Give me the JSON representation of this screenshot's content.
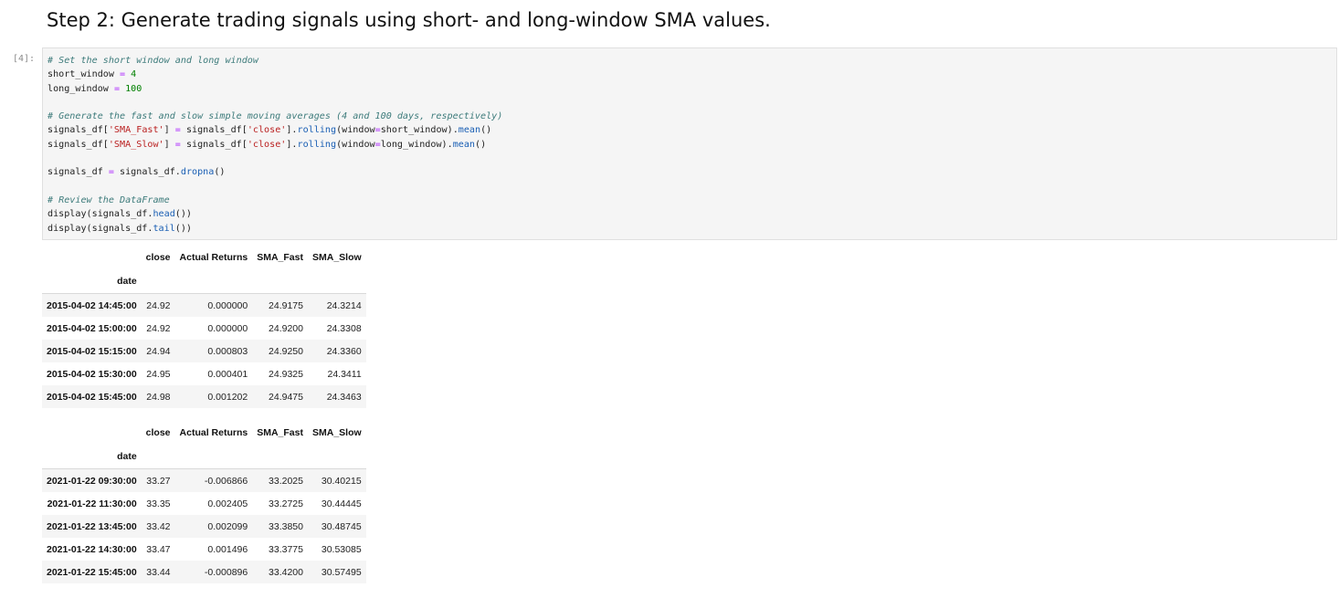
{
  "heading": "Step 2: Generate trading signals using short- and long-window SMA values.",
  "cell": {
    "prompt": "[4]:",
    "lines": [
      [
        [
          "comment",
          "# Set the short window and long window"
        ]
      ],
      [
        [
          "plain",
          "short_window "
        ],
        [
          "op",
          "="
        ],
        [
          "plain",
          " "
        ],
        [
          "number",
          "4"
        ]
      ],
      [
        [
          "plain",
          "long_window "
        ],
        [
          "op",
          "="
        ],
        [
          "plain",
          " "
        ],
        [
          "number",
          "100"
        ]
      ],
      [],
      [
        [
          "comment",
          "# Generate the fast and slow simple moving averages (4 and 100 days, respectively)"
        ]
      ],
      [
        [
          "plain",
          "signals_df["
        ],
        [
          "string",
          "'SMA_Fast'"
        ],
        [
          "plain",
          "] "
        ],
        [
          "op",
          "="
        ],
        [
          "plain",
          " signals_df["
        ],
        [
          "string",
          "'close'"
        ],
        [
          "plain",
          "]."
        ],
        [
          "attr",
          "rolling"
        ],
        [
          "plain",
          "(window"
        ],
        [
          "op",
          "="
        ],
        [
          "plain",
          "short_window)."
        ],
        [
          "attr",
          "mean"
        ],
        [
          "plain",
          "()"
        ]
      ],
      [
        [
          "plain",
          "signals_df["
        ],
        [
          "string",
          "'SMA_Slow'"
        ],
        [
          "plain",
          "] "
        ],
        [
          "op",
          "="
        ],
        [
          "plain",
          " signals_df["
        ],
        [
          "string",
          "'close'"
        ],
        [
          "plain",
          "]."
        ],
        [
          "attr",
          "rolling"
        ],
        [
          "plain",
          "(window"
        ],
        [
          "op",
          "="
        ],
        [
          "plain",
          "long_window)."
        ],
        [
          "attr",
          "mean"
        ],
        [
          "plain",
          "()"
        ]
      ],
      [],
      [
        [
          "plain",
          "signals_df "
        ],
        [
          "op",
          "="
        ],
        [
          "plain",
          " signals_df."
        ],
        [
          "attr",
          "dropna"
        ],
        [
          "plain",
          "()"
        ]
      ],
      [],
      [
        [
          "comment",
          "# Review the DataFrame"
        ]
      ],
      [
        [
          "plain",
          "display(signals_df."
        ],
        [
          "attr",
          "head"
        ],
        [
          "plain",
          "())"
        ]
      ],
      [
        [
          "plain",
          "display(signals_df."
        ],
        [
          "attr",
          "tail"
        ],
        [
          "plain",
          "())"
        ]
      ]
    ]
  },
  "outputs": {
    "head": {
      "columns": [
        "close",
        "Actual Returns",
        "SMA_Fast",
        "SMA_Slow"
      ],
      "index_name": "date",
      "rows": [
        [
          "2015-04-02 14:45:00",
          "24.92",
          "0.000000",
          "24.9175",
          "24.3214"
        ],
        [
          "2015-04-02 15:00:00",
          "24.92",
          "0.000000",
          "24.9200",
          "24.3308"
        ],
        [
          "2015-04-02 15:15:00",
          "24.94",
          "0.000803",
          "24.9250",
          "24.3360"
        ],
        [
          "2015-04-02 15:30:00",
          "24.95",
          "0.000401",
          "24.9325",
          "24.3411"
        ],
        [
          "2015-04-02 15:45:00",
          "24.98",
          "0.001202",
          "24.9475",
          "24.3463"
        ]
      ]
    },
    "tail": {
      "columns": [
        "close",
        "Actual Returns",
        "SMA_Fast",
        "SMA_Slow"
      ],
      "index_name": "date",
      "rows": [
        [
          "2021-01-22 09:30:00",
          "33.27",
          "-0.006866",
          "33.2025",
          "30.40215"
        ],
        [
          "2021-01-22 11:30:00",
          "33.35",
          "0.002405",
          "33.2725",
          "30.44445"
        ],
        [
          "2021-01-22 13:45:00",
          "33.42",
          "0.002099",
          "33.3850",
          "30.48745"
        ],
        [
          "2021-01-22 14:30:00",
          "33.47",
          "0.001496",
          "33.3775",
          "30.53085"
        ],
        [
          "2021-01-22 15:45:00",
          "33.44",
          "-0.000896",
          "33.4200",
          "30.57495"
        ]
      ]
    }
  }
}
